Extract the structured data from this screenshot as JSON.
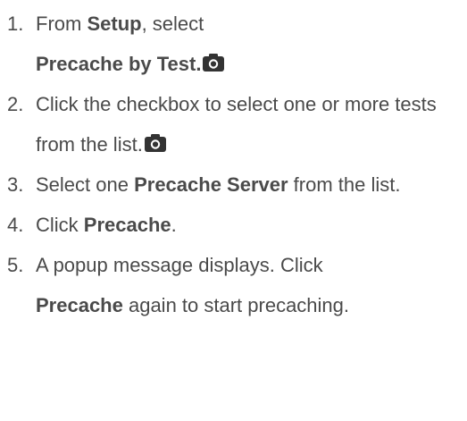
{
  "steps": [
    {
      "number": "1.",
      "parts": [
        "From ",
        "Setup",
        ", select ",
        "Precache by Test."
      ]
    },
    {
      "number": "2.",
      "parts": [
        "Click the checkbox to select one or more tests from the list."
      ]
    },
    {
      "number": "3.",
      "parts": [
        "Select one ",
        "Precache Server",
        " from the list."
      ]
    },
    {
      "number": "4.",
      "parts": [
        "Click ",
        "Precache",
        "."
      ]
    },
    {
      "number": "5.",
      "parts": [
        "A popup message displays. Click ",
        "Precache",
        " again to start precaching."
      ]
    }
  ],
  "icons": {
    "screenshot_icon": "camera-icon",
    "icon_color": "#333333"
  },
  "colors": {
    "text": "#4a4a4a",
    "background": "#ffffff"
  }
}
